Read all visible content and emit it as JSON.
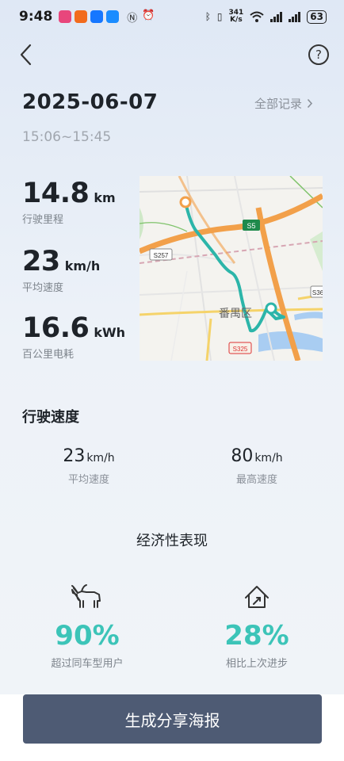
{
  "status_bar": {
    "time": "9:48",
    "net_speed_value": "341",
    "net_speed_unit": "K/s",
    "battery": "63"
  },
  "header": {
    "date": "2025-06-07",
    "all_records_label": "全部记录",
    "time_range": "15:06~15:45"
  },
  "stats": [
    {
      "value": "14.8",
      "unit": "km",
      "label": "行驶里程"
    },
    {
      "value": "23",
      "unit": "km/h",
      "label": "平均速度"
    },
    {
      "value": "16.6",
      "unit": "kWh",
      "label": "百公里电耗"
    }
  ],
  "map": {
    "road_labels": [
      "S5",
      "S257",
      "S36",
      "S325"
    ],
    "district_label": "番禺区"
  },
  "driving_speed": {
    "title": "行驶速度",
    "avg": {
      "value": "23",
      "unit": "km/h",
      "label": "平均速度"
    },
    "max": {
      "value": "80",
      "unit": "km/h",
      "label": "最高速度"
    }
  },
  "economy": {
    "title": "经济性表现",
    "beat": {
      "value": "90%",
      "label": "超过同车型用户",
      "icon": "ox-icon"
    },
    "progress": {
      "value": "28%",
      "label": "相比上次进步",
      "icon": "home-up-icon"
    }
  },
  "share_button_label": "生成分享海报",
  "colors": {
    "accent": "#3cc4b8",
    "button": "#4e5b74",
    "route": "#2cb5a9",
    "expressway": "#f2a04a"
  }
}
